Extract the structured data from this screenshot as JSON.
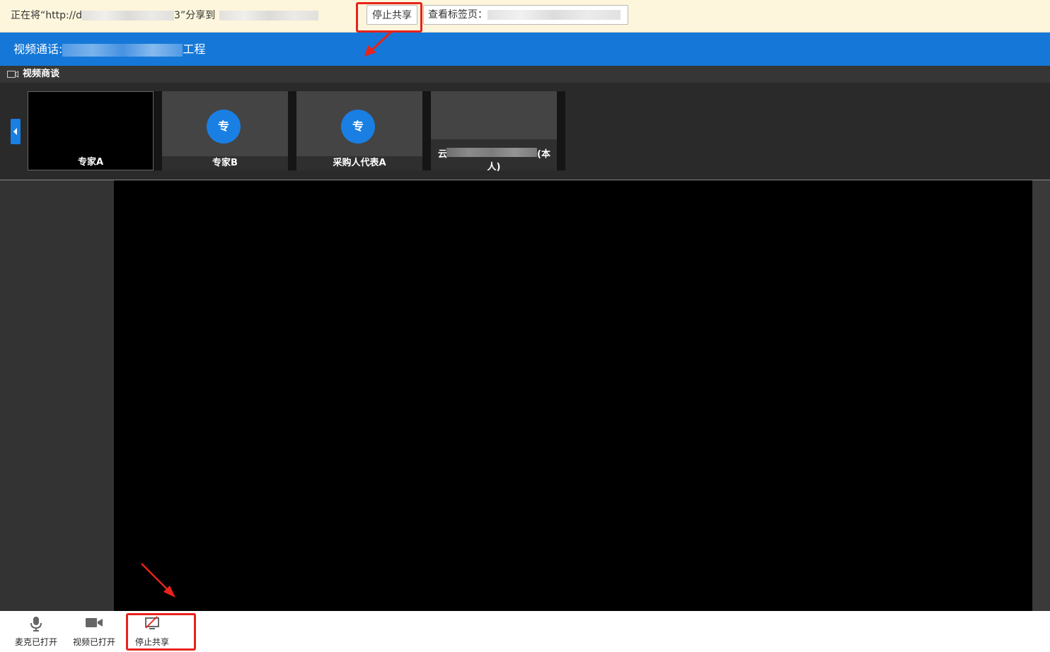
{
  "share_bar": {
    "prefix": "正在将“http://d",
    "middle": "3”分享到",
    "stop_button": "停止共享",
    "view_tab_label": "查看标签页："
  },
  "title_bar": {
    "prefix": "视频通话:",
    "suffix": "工程"
  },
  "section": {
    "label": "视频商谈",
    "icon": "camera-icon"
  },
  "participants": [
    {
      "name": "专家A",
      "avatar": ""
    },
    {
      "name": "专家B",
      "avatar": "专"
    },
    {
      "name": "采购人代表A",
      "avatar": "专"
    },
    {
      "name_line1_suffix": "(本",
      "name_line2": "人)",
      "name_line1_prefix": "云"
    }
  ],
  "toolbar": {
    "mic_label": "麦克已打开",
    "video_label": "视频已打开",
    "stop_share_label": "停止共享"
  },
  "colors": {
    "accent": "#1578d8",
    "highlight": "#e8231b",
    "share_bar_bg": "#fdf6dc"
  }
}
